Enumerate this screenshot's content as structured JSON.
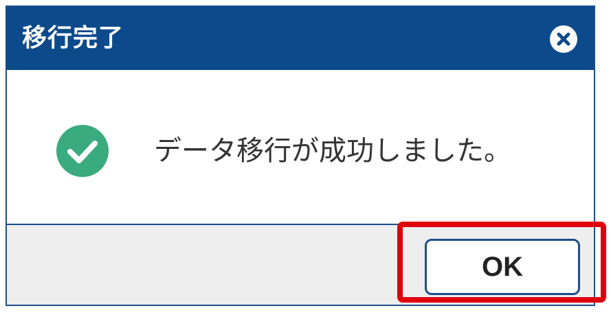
{
  "dialog": {
    "title": "移行完了",
    "message": "データ移行が成功しました。",
    "ok_label": "OK",
    "icons": {
      "close": "close-icon",
      "status": "check-circle-icon"
    }
  },
  "colors": {
    "titlebar": "#0d4a8b",
    "success": "#3aaa7f",
    "footer": "#eeeeee",
    "highlight": "#e0000b"
  }
}
